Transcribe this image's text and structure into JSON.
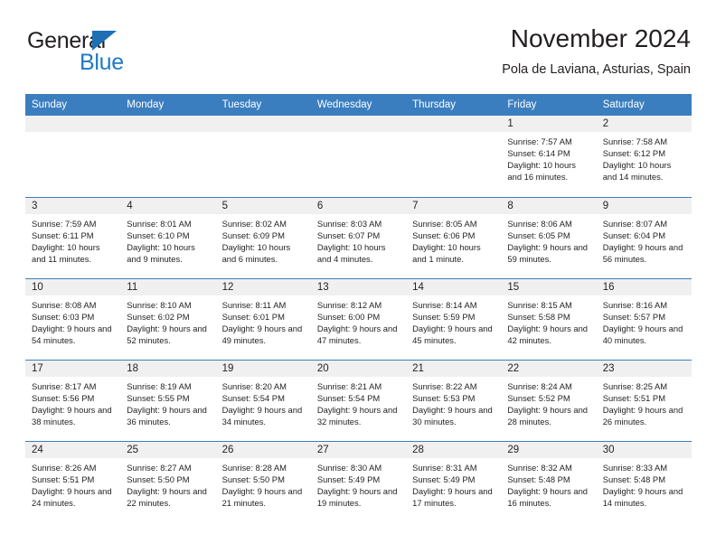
{
  "brand": {
    "name_part1": "General",
    "name_part2": "Blue",
    "triangle_color": "#1f6fb4",
    "blue_color": "#1f7ac4"
  },
  "header": {
    "title": "November 2024",
    "subtitle": "Pola de Laviana, Asturias, Spain"
  },
  "theme": {
    "header_blue": "#3b7ebf",
    "daynum_band": "#f0f0f0",
    "text": "#231f20"
  },
  "calendar": {
    "weekday_headers": [
      "Sunday",
      "Monday",
      "Tuesday",
      "Wednesday",
      "Thursday",
      "Friday",
      "Saturday"
    ],
    "weeks": [
      [
        {
          "day": "",
          "empty": true,
          "sunrise": "",
          "sunset": "",
          "daylight": ""
        },
        {
          "day": "",
          "empty": true,
          "sunrise": "",
          "sunset": "",
          "daylight": ""
        },
        {
          "day": "",
          "empty": true,
          "sunrise": "",
          "sunset": "",
          "daylight": ""
        },
        {
          "day": "",
          "empty": true,
          "sunrise": "",
          "sunset": "",
          "daylight": ""
        },
        {
          "day": "",
          "empty": true,
          "sunrise": "",
          "sunset": "",
          "daylight": ""
        },
        {
          "day": "1",
          "empty": false,
          "sunrise": "Sunrise: 7:57 AM",
          "sunset": "Sunset: 6:14 PM",
          "daylight": "Daylight: 10 hours and 16 minutes."
        },
        {
          "day": "2",
          "empty": false,
          "sunrise": "Sunrise: 7:58 AM",
          "sunset": "Sunset: 6:12 PM",
          "daylight": "Daylight: 10 hours and 14 minutes."
        }
      ],
      [
        {
          "day": "3",
          "empty": false,
          "sunrise": "Sunrise: 7:59 AM",
          "sunset": "Sunset: 6:11 PM",
          "daylight": "Daylight: 10 hours and 11 minutes."
        },
        {
          "day": "4",
          "empty": false,
          "sunrise": "Sunrise: 8:01 AM",
          "sunset": "Sunset: 6:10 PM",
          "daylight": "Daylight: 10 hours and 9 minutes."
        },
        {
          "day": "5",
          "empty": false,
          "sunrise": "Sunrise: 8:02 AM",
          "sunset": "Sunset: 6:09 PM",
          "daylight": "Daylight: 10 hours and 6 minutes."
        },
        {
          "day": "6",
          "empty": false,
          "sunrise": "Sunrise: 8:03 AM",
          "sunset": "Sunset: 6:07 PM",
          "daylight": "Daylight: 10 hours and 4 minutes."
        },
        {
          "day": "7",
          "empty": false,
          "sunrise": "Sunrise: 8:05 AM",
          "sunset": "Sunset: 6:06 PM",
          "daylight": "Daylight: 10 hours and 1 minute."
        },
        {
          "day": "8",
          "empty": false,
          "sunrise": "Sunrise: 8:06 AM",
          "sunset": "Sunset: 6:05 PM",
          "daylight": "Daylight: 9 hours and 59 minutes."
        },
        {
          "day": "9",
          "empty": false,
          "sunrise": "Sunrise: 8:07 AM",
          "sunset": "Sunset: 6:04 PM",
          "daylight": "Daylight: 9 hours and 56 minutes."
        }
      ],
      [
        {
          "day": "10",
          "empty": false,
          "sunrise": "Sunrise: 8:08 AM",
          "sunset": "Sunset: 6:03 PM",
          "daylight": "Daylight: 9 hours and 54 minutes."
        },
        {
          "day": "11",
          "empty": false,
          "sunrise": "Sunrise: 8:10 AM",
          "sunset": "Sunset: 6:02 PM",
          "daylight": "Daylight: 9 hours and 52 minutes."
        },
        {
          "day": "12",
          "empty": false,
          "sunrise": "Sunrise: 8:11 AM",
          "sunset": "Sunset: 6:01 PM",
          "daylight": "Daylight: 9 hours and 49 minutes."
        },
        {
          "day": "13",
          "empty": false,
          "sunrise": "Sunrise: 8:12 AM",
          "sunset": "Sunset: 6:00 PM",
          "daylight": "Daylight: 9 hours and 47 minutes."
        },
        {
          "day": "14",
          "empty": false,
          "sunrise": "Sunrise: 8:14 AM",
          "sunset": "Sunset: 5:59 PM",
          "daylight": "Daylight: 9 hours and 45 minutes."
        },
        {
          "day": "15",
          "empty": false,
          "sunrise": "Sunrise: 8:15 AM",
          "sunset": "Sunset: 5:58 PM",
          "daylight": "Daylight: 9 hours and 42 minutes."
        },
        {
          "day": "16",
          "empty": false,
          "sunrise": "Sunrise: 8:16 AM",
          "sunset": "Sunset: 5:57 PM",
          "daylight": "Daylight: 9 hours and 40 minutes."
        }
      ],
      [
        {
          "day": "17",
          "empty": false,
          "sunrise": "Sunrise: 8:17 AM",
          "sunset": "Sunset: 5:56 PM",
          "daylight": "Daylight: 9 hours and 38 minutes."
        },
        {
          "day": "18",
          "empty": false,
          "sunrise": "Sunrise: 8:19 AM",
          "sunset": "Sunset: 5:55 PM",
          "daylight": "Daylight: 9 hours and 36 minutes."
        },
        {
          "day": "19",
          "empty": false,
          "sunrise": "Sunrise: 8:20 AM",
          "sunset": "Sunset: 5:54 PM",
          "daylight": "Daylight: 9 hours and 34 minutes."
        },
        {
          "day": "20",
          "empty": false,
          "sunrise": "Sunrise: 8:21 AM",
          "sunset": "Sunset: 5:54 PM",
          "daylight": "Daylight: 9 hours and 32 minutes."
        },
        {
          "day": "21",
          "empty": false,
          "sunrise": "Sunrise: 8:22 AM",
          "sunset": "Sunset: 5:53 PM",
          "daylight": "Daylight: 9 hours and 30 minutes."
        },
        {
          "day": "22",
          "empty": false,
          "sunrise": "Sunrise: 8:24 AM",
          "sunset": "Sunset: 5:52 PM",
          "daylight": "Daylight: 9 hours and 28 minutes."
        },
        {
          "day": "23",
          "empty": false,
          "sunrise": "Sunrise: 8:25 AM",
          "sunset": "Sunset: 5:51 PM",
          "daylight": "Daylight: 9 hours and 26 minutes."
        }
      ],
      [
        {
          "day": "24",
          "empty": false,
          "sunrise": "Sunrise: 8:26 AM",
          "sunset": "Sunset: 5:51 PM",
          "daylight": "Daylight: 9 hours and 24 minutes."
        },
        {
          "day": "25",
          "empty": false,
          "sunrise": "Sunrise: 8:27 AM",
          "sunset": "Sunset: 5:50 PM",
          "daylight": "Daylight: 9 hours and 22 minutes."
        },
        {
          "day": "26",
          "empty": false,
          "sunrise": "Sunrise: 8:28 AM",
          "sunset": "Sunset: 5:50 PM",
          "daylight": "Daylight: 9 hours and 21 minutes."
        },
        {
          "day": "27",
          "empty": false,
          "sunrise": "Sunrise: 8:30 AM",
          "sunset": "Sunset: 5:49 PM",
          "daylight": "Daylight: 9 hours and 19 minutes."
        },
        {
          "day": "28",
          "empty": false,
          "sunrise": "Sunrise: 8:31 AM",
          "sunset": "Sunset: 5:49 PM",
          "daylight": "Daylight: 9 hours and 17 minutes."
        },
        {
          "day": "29",
          "empty": false,
          "sunrise": "Sunrise: 8:32 AM",
          "sunset": "Sunset: 5:48 PM",
          "daylight": "Daylight: 9 hours and 16 minutes."
        },
        {
          "day": "30",
          "empty": false,
          "sunrise": "Sunrise: 8:33 AM",
          "sunset": "Sunset: 5:48 PM",
          "daylight": "Daylight: 9 hours and 14 minutes."
        }
      ]
    ]
  }
}
